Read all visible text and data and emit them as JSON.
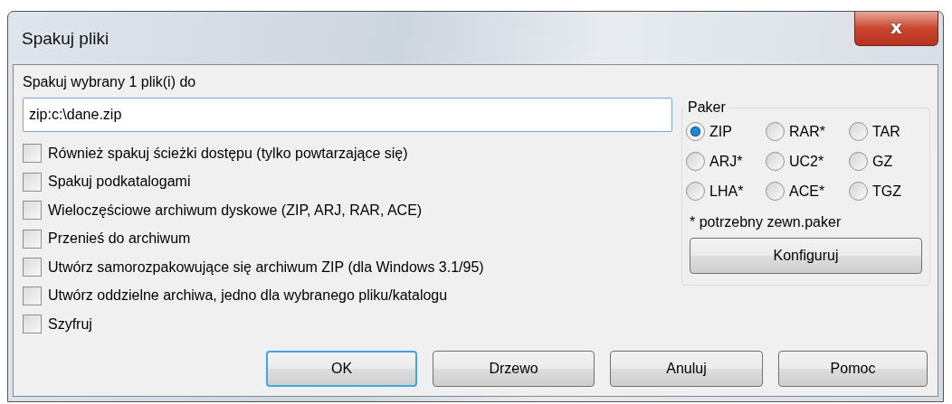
{
  "window": {
    "title": "Spakuj pliki",
    "close": "x"
  },
  "target": {
    "label": "Spakuj wybrany 1 plik(i) do",
    "value": "zip:c:\\dane.zip"
  },
  "options": [
    {
      "label": "Również spakuj ścieżki dostępu (tylko powtarzające się)",
      "checked": false
    },
    {
      "label": "Spakuj podkatalogami",
      "checked": false
    },
    {
      "label": "Wieloczęściowe archiwum dyskowe (ZIP, ARJ, RAR, ACE)",
      "checked": false
    },
    {
      "label": "Przenieś do archiwum",
      "checked": false
    },
    {
      "label": "Utwórz samorozpakowujące się archiwum ZIP (dla Windows 3.1/95)",
      "checked": false
    },
    {
      "label": "Utwórz oddzielne archiwa, jedno dla wybranego pliku/katalogu",
      "checked": false
    },
    {
      "label": "Szyfruj",
      "checked": false
    }
  ],
  "packer": {
    "title": "Paker",
    "choices": [
      {
        "label": "ZIP",
        "selected": true
      },
      {
        "label": "RAR*",
        "selected": false
      },
      {
        "label": "TAR",
        "selected": false
      },
      {
        "label": "ARJ*",
        "selected": false
      },
      {
        "label": "UC2*",
        "selected": false
      },
      {
        "label": "GZ",
        "selected": false
      },
      {
        "label": "LHA*",
        "selected": false
      },
      {
        "label": "ACE*",
        "selected": false
      },
      {
        "label": "TGZ",
        "selected": false
      }
    ],
    "note": "* potrzebny zewn.paker",
    "configure": {
      "label": "Konfiguruj"
    }
  },
  "buttons": [
    {
      "label": "OK",
      "default": true
    },
    {
      "label": "Drzewo",
      "default": false
    },
    {
      "label": "Anuluj",
      "default": false
    },
    {
      "label": "Pomoc",
      "default": false
    }
  ]
}
